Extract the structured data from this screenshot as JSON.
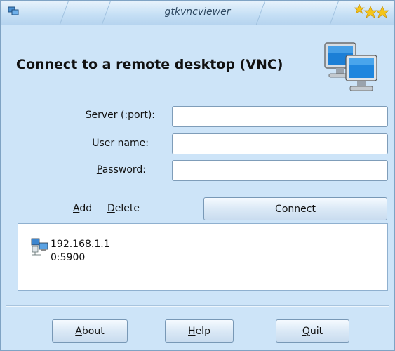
{
  "window": {
    "title": "gtkvncviewer"
  },
  "heading": "Connect to a remote desktop (VNC)",
  "form": {
    "server": {
      "label_mnemonic": "S",
      "label_rest": "erver (:port):",
      "value": ""
    },
    "username": {
      "label_mnemonic": "U",
      "label_rest": "ser name:",
      "value": ""
    },
    "password": {
      "label_mnemonic": "P",
      "label_rest": "assword:",
      "value": ""
    }
  },
  "actions": {
    "add_mnemonic": "A",
    "add_rest": "dd",
    "delete_mnemonic": "D",
    "delete_rest": "elete",
    "connect_pre": "C",
    "connect_mnemonic": "o",
    "connect_rest": "nnect"
  },
  "saved_connections": [
    {
      "host": "192.168.1.1",
      "port": "0:5900",
      "icon": "network-computer-icon"
    }
  ],
  "footer": {
    "about_mnemonic": "A",
    "about_rest": "bout",
    "help_mnemonic": "H",
    "help_rest": "elp",
    "quit_mnemonic": "Q",
    "quit_rest": "uit"
  },
  "colors": {
    "window_bg": "#cde4f8",
    "titlebar": "#c5dff5",
    "field_border": "#7f9db9",
    "star": "#f5c518"
  }
}
